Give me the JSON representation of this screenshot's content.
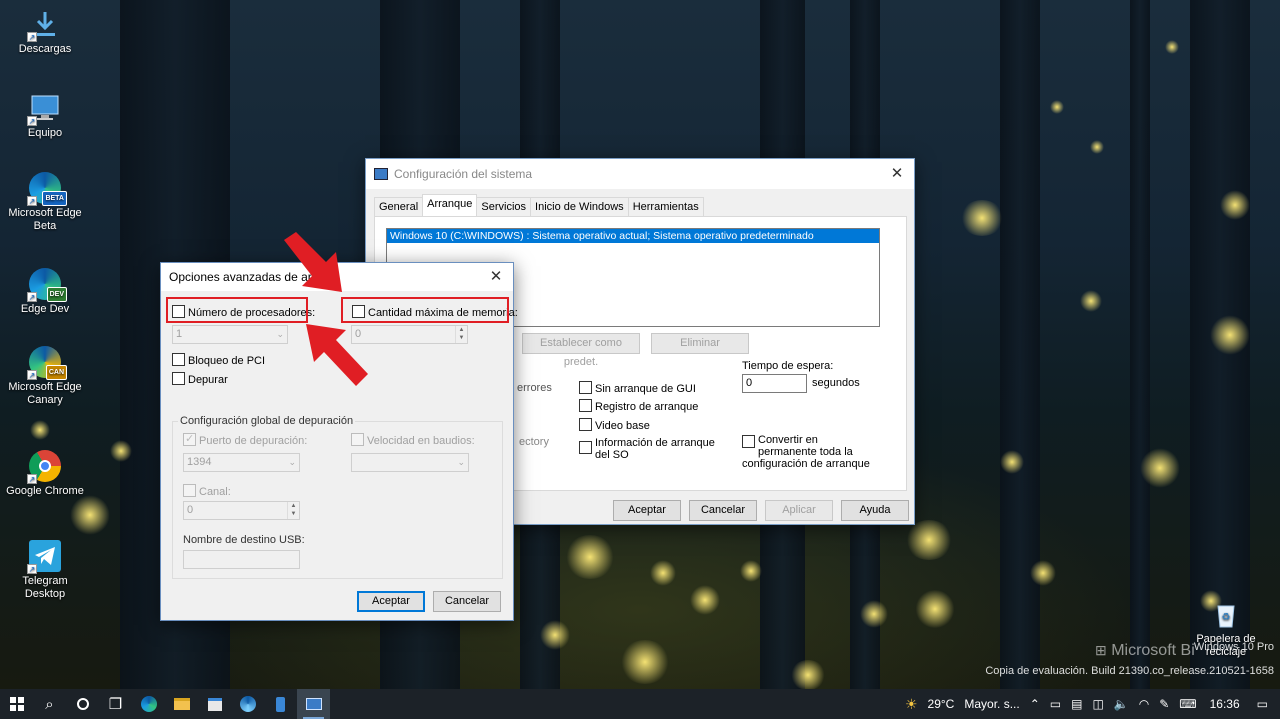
{
  "desktop": {
    "icons": [
      {
        "label": "Descargas"
      },
      {
        "label": "Equipo"
      },
      {
        "label": "Microsoft Edge Beta",
        "badge": "BETA"
      },
      {
        "label": "Edge Dev",
        "badge": "DEV"
      },
      {
        "label": "Microsoft Edge Canary",
        "badge": "CAN"
      },
      {
        "label": "Google Chrome"
      },
      {
        "label": "Telegram Desktop"
      },
      {
        "label": "Papelera de reciclaje"
      }
    ],
    "watermark": {
      "line1": "Windows 10 Pro",
      "line2": "Copia de evaluación. Build 21390.co_release.210521-1658",
      "logo": "Microsoft Bi"
    }
  },
  "syscfg": {
    "title": "Configuración del sistema",
    "tabs": [
      "General",
      "Arranque",
      "Servicios",
      "Inicio de Windows",
      "Herramientas"
    ],
    "os_entry": "Windows 10 (C:\\WINDOWS) : Sistema operativo actual; Sistema operativo predeterminado",
    "set_default_label": "Establecer como predet.",
    "delete_label": "Eliminar",
    "errors_partial": "errores",
    "directory_partial": "ectory",
    "boot_options": [
      "Sin arranque de GUI",
      "Registro de arranque",
      "Video base",
      "Información de arranque del SO"
    ],
    "timeout_label": "Tiempo de espera:",
    "timeout_value": "0",
    "seconds_label": "segundos",
    "permanent_label": "Convertir en permanente toda la configuración de arranque",
    "ok_label": "Aceptar",
    "cancel_label": "Cancelar",
    "apply_label": "Aplicar",
    "help_label": "Ayuda"
  },
  "advanced": {
    "title": "Opciones avanzadas de arra",
    "num_processors_label": "Número de procesadores:",
    "num_processors_value": "1",
    "max_memory_label": "Cantidad máxima de memoria:",
    "max_memory_value": "0",
    "pci_lock_label": "Bloqueo de PCI",
    "debug_label": "Depurar",
    "global_debug_group": "Configuración global de depuración",
    "debug_port_label": "Puerto de depuración:",
    "debug_port_value": "1394",
    "baud_rate_label": "Velocidad en baudios:",
    "channel_label": "Canal:",
    "channel_value": "0",
    "usb_target_label": "Nombre de destino USB:",
    "ok_label": "Aceptar",
    "cancel_label": "Cancelar"
  },
  "taskbar": {
    "weather": "29°C",
    "weather_text": "Mayor. s...",
    "time": "16:36"
  },
  "colors": {
    "highlight": "#e01e24",
    "selection": "#0078d7"
  }
}
